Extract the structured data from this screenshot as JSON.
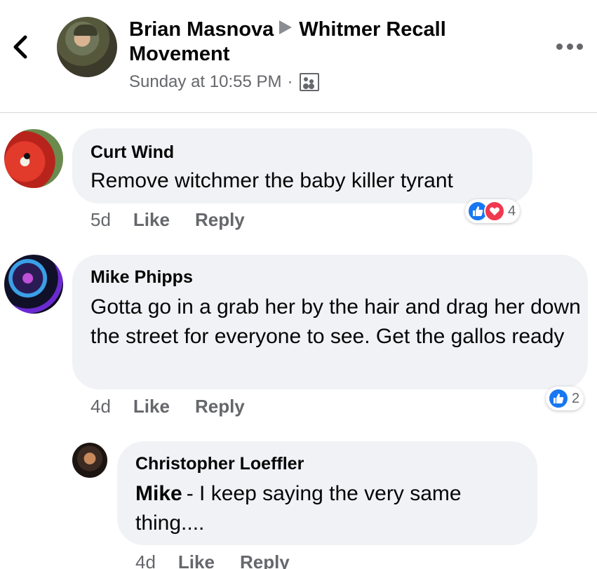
{
  "header": {
    "author": "Brian Masnova",
    "group_line1": "Whitmer Recall",
    "group_line2": "Movement",
    "timestamp": "Sunday at 10:55 PM",
    "separator": "·",
    "icons": {
      "back": "chevron-left-icon",
      "privacy": "group-icon",
      "more": "more-options-icon"
    }
  },
  "comments": [
    {
      "author": "Curt Wind",
      "text": "Remove witchmer the baby killer tyrant",
      "time": "5d",
      "like_label": "Like",
      "reply_label": "Reply",
      "reactions": {
        "types": [
          "like",
          "love"
        ],
        "count": "4"
      }
    },
    {
      "author": "Mike Phipps",
      "text": "Gotta go in a grab her by the hair and drag her down the street for everyone to see. Get the gallos ready",
      "time": "4d",
      "like_label": "Like",
      "reply_label": "Reply",
      "reactions": {
        "types": [
          "like"
        ],
        "count": "2"
      }
    }
  ],
  "reply": {
    "author": "Christopher Loeffler",
    "mention": "Mike",
    "text": "- I keep saying the very same thing....",
    "time": "4d",
    "like_label": "Like",
    "reply_label": "Reply"
  },
  "colors": {
    "accent_like": "#1877f2",
    "accent_love": "#f0384f",
    "bubble": "#f0f2f5",
    "secondary_text": "#65676b"
  }
}
